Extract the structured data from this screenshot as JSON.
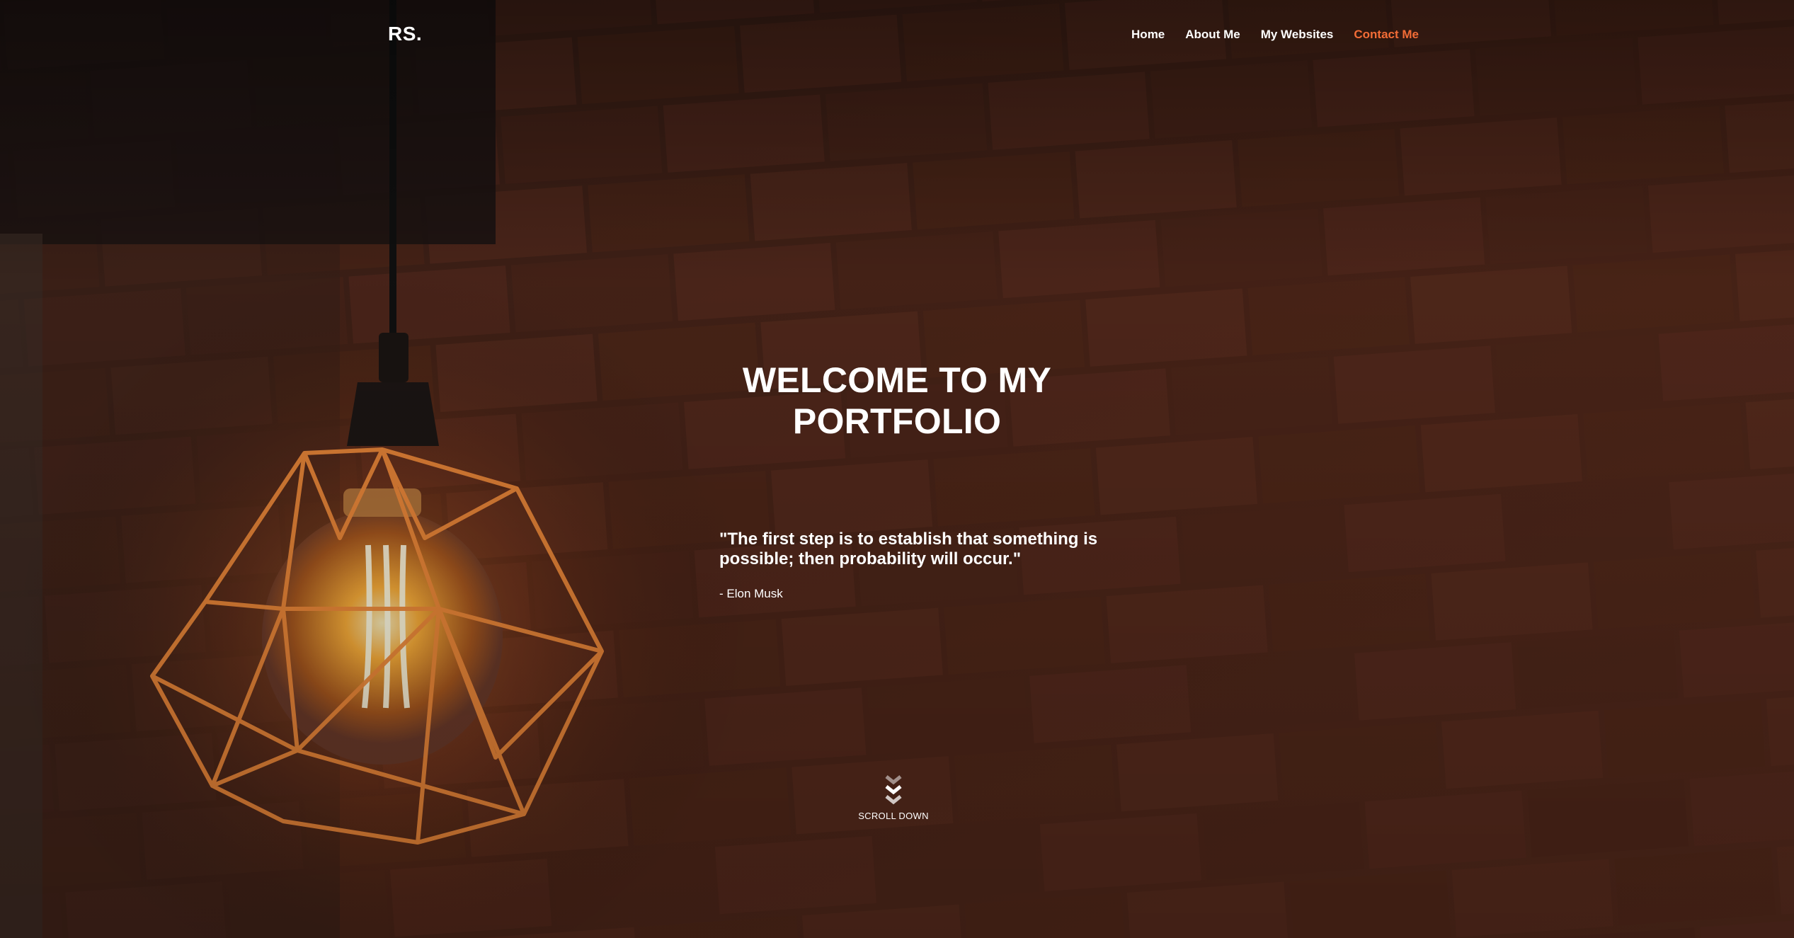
{
  "header": {
    "logo": "RS.",
    "nav": [
      {
        "label": "Home",
        "active": false
      },
      {
        "label": "About Me",
        "active": false
      },
      {
        "label": "My Websites",
        "active": false
      },
      {
        "label": "Contact Me",
        "active": true
      }
    ]
  },
  "hero": {
    "title_line1": "WELCOME TO MY",
    "title_line2": "PORTFOLIO",
    "quote": "\"The first step is to establish that something is possible; then probability will occur.\"",
    "author": "- Elon Musk",
    "scroll_label": "SCROLL DOWN"
  },
  "colors": {
    "accent": "#f26c36",
    "text": "#ffffff",
    "background": "#2a1610"
  },
  "icons": {
    "scroll": "double-chevron-down-icon",
    "background": "hanging-lamp-brick-wall-photo"
  }
}
